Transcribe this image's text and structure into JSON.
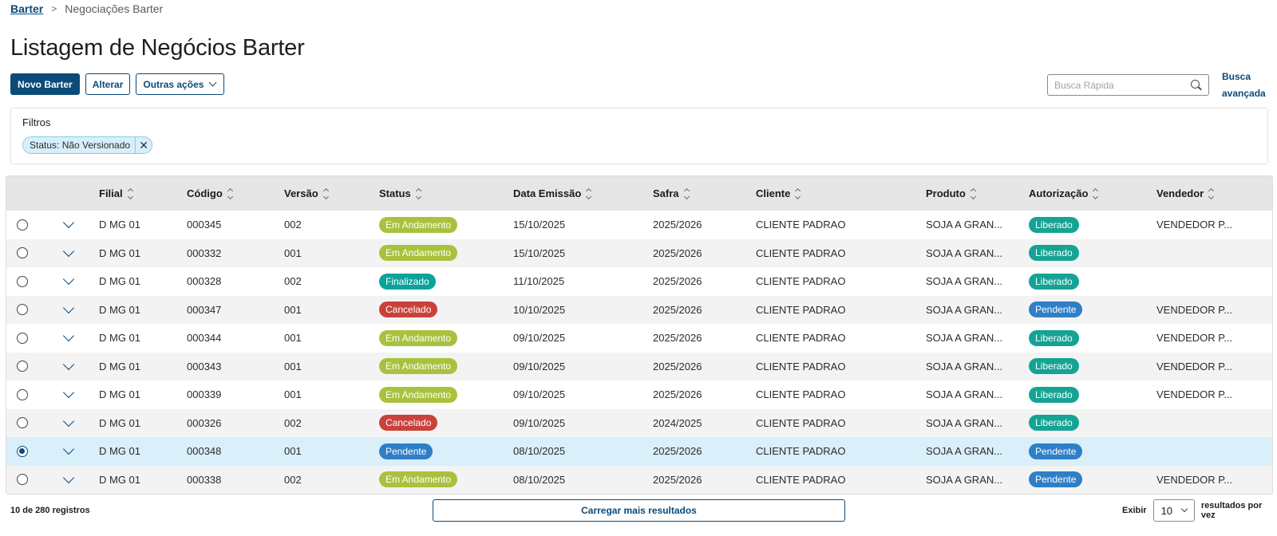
{
  "breadcrumb": {
    "root": "Barter",
    "current": "Negociações Barter"
  },
  "page": {
    "title": "Listagem de Negócios Barter"
  },
  "toolbar": {
    "new_label": "Novo Barter",
    "edit_label": "Alterar",
    "more_label": "Outras ações"
  },
  "search": {
    "placeholder": "Busca Rápida",
    "advanced_label": "Busca avançada"
  },
  "filters": {
    "label": "Filtros",
    "chips": [
      "Status: Não Versionado"
    ]
  },
  "table": {
    "columns": [
      "Filial",
      "Código",
      "Versão",
      "Status",
      "Data Emissão",
      "Safra",
      "Cliente",
      "Produto",
      "Autorização",
      "Vendedor"
    ],
    "status_colors": {
      "Em Andamento": "#a8c23e",
      "Finalizado": "#0aa39a",
      "Cancelado": "#c9423a",
      "Pendente": "#2f7fc7"
    },
    "auth_colors": {
      "Liberado": "#16a394",
      "Pendente": "#2f7fc7"
    },
    "rows": [
      {
        "selected": false,
        "filial": "D MG 01",
        "codigo": "000345",
        "versao": "002",
        "status": "Em Andamento",
        "data": "15/10/2025",
        "safra": "2025/2026",
        "cliente": "CLIENTE PADRAO",
        "produto": "SOJA A GRAN...",
        "autorizacao": "Liberado",
        "vendedor": "VENDEDOR P..."
      },
      {
        "selected": false,
        "filial": "D MG 01",
        "codigo": "000332",
        "versao": "001",
        "status": "Em Andamento",
        "data": "15/10/2025",
        "safra": "2025/2026",
        "cliente": "CLIENTE PADRAO",
        "produto": "SOJA A GRAN...",
        "autorizacao": "Liberado",
        "vendedor": ""
      },
      {
        "selected": false,
        "filial": "D MG 01",
        "codigo": "000328",
        "versao": "002",
        "status": "Finalizado",
        "data": "11/10/2025",
        "safra": "2025/2026",
        "cliente": "CLIENTE PADRAO",
        "produto": "SOJA A GRAN...",
        "autorizacao": "Liberado",
        "vendedor": ""
      },
      {
        "selected": false,
        "filial": "D MG 01",
        "codigo": "000347",
        "versao": "001",
        "status": "Cancelado",
        "data": "10/10/2025",
        "safra": "2025/2026",
        "cliente": "CLIENTE PADRAO",
        "produto": "SOJA A GRAN...",
        "autorizacao": "Pendente",
        "vendedor": "VENDEDOR P..."
      },
      {
        "selected": false,
        "filial": "D MG 01",
        "codigo": "000344",
        "versao": "001",
        "status": "Em Andamento",
        "data": "09/10/2025",
        "safra": "2025/2026",
        "cliente": "CLIENTE PADRAO",
        "produto": "SOJA A GRAN...",
        "autorizacao": "Liberado",
        "vendedor": "VENDEDOR P..."
      },
      {
        "selected": false,
        "filial": "D MG 01",
        "codigo": "000343",
        "versao": "001",
        "status": "Em Andamento",
        "data": "09/10/2025",
        "safra": "2025/2026",
        "cliente": "CLIENTE PADRAO",
        "produto": "SOJA A GRAN...",
        "autorizacao": "Liberado",
        "vendedor": "VENDEDOR P..."
      },
      {
        "selected": false,
        "filial": "D MG 01",
        "codigo": "000339",
        "versao": "001",
        "status": "Em Andamento",
        "data": "09/10/2025",
        "safra": "2025/2026",
        "cliente": "CLIENTE PADRAO",
        "produto": "SOJA A GRAN...",
        "autorizacao": "Liberado",
        "vendedor": "VENDEDOR P..."
      },
      {
        "selected": false,
        "filial": "D MG 01",
        "codigo": "000326",
        "versao": "002",
        "status": "Cancelado",
        "data": "09/10/2025",
        "safra": "2024/2025",
        "cliente": "CLIENTE PADRAO",
        "produto": "SOJA A GRAN...",
        "autorizacao": "Liberado",
        "vendedor": ""
      },
      {
        "selected": true,
        "filial": "D MG 01",
        "codigo": "000348",
        "versao": "001",
        "status": "Pendente",
        "data": "08/10/2025",
        "safra": "2025/2026",
        "cliente": "CLIENTE PADRAO",
        "produto": "SOJA A GRAN...",
        "autorizacao": "Pendente",
        "vendedor": ""
      },
      {
        "selected": false,
        "filial": "D MG 01",
        "codigo": "000338",
        "versao": "002",
        "status": "Em Andamento",
        "data": "08/10/2025",
        "safra": "2025/2026",
        "cliente": "CLIENTE PADRAO",
        "produto": "SOJA A GRAN...",
        "autorizacao": "Pendente",
        "vendedor": "VENDEDOR P..."
      }
    ]
  },
  "footer": {
    "count": "10 de 280 registros",
    "load_more": "Carregar mais resultados",
    "show_label": "Exibir",
    "page_size": "10",
    "per_page_label": "resultados por vez"
  }
}
